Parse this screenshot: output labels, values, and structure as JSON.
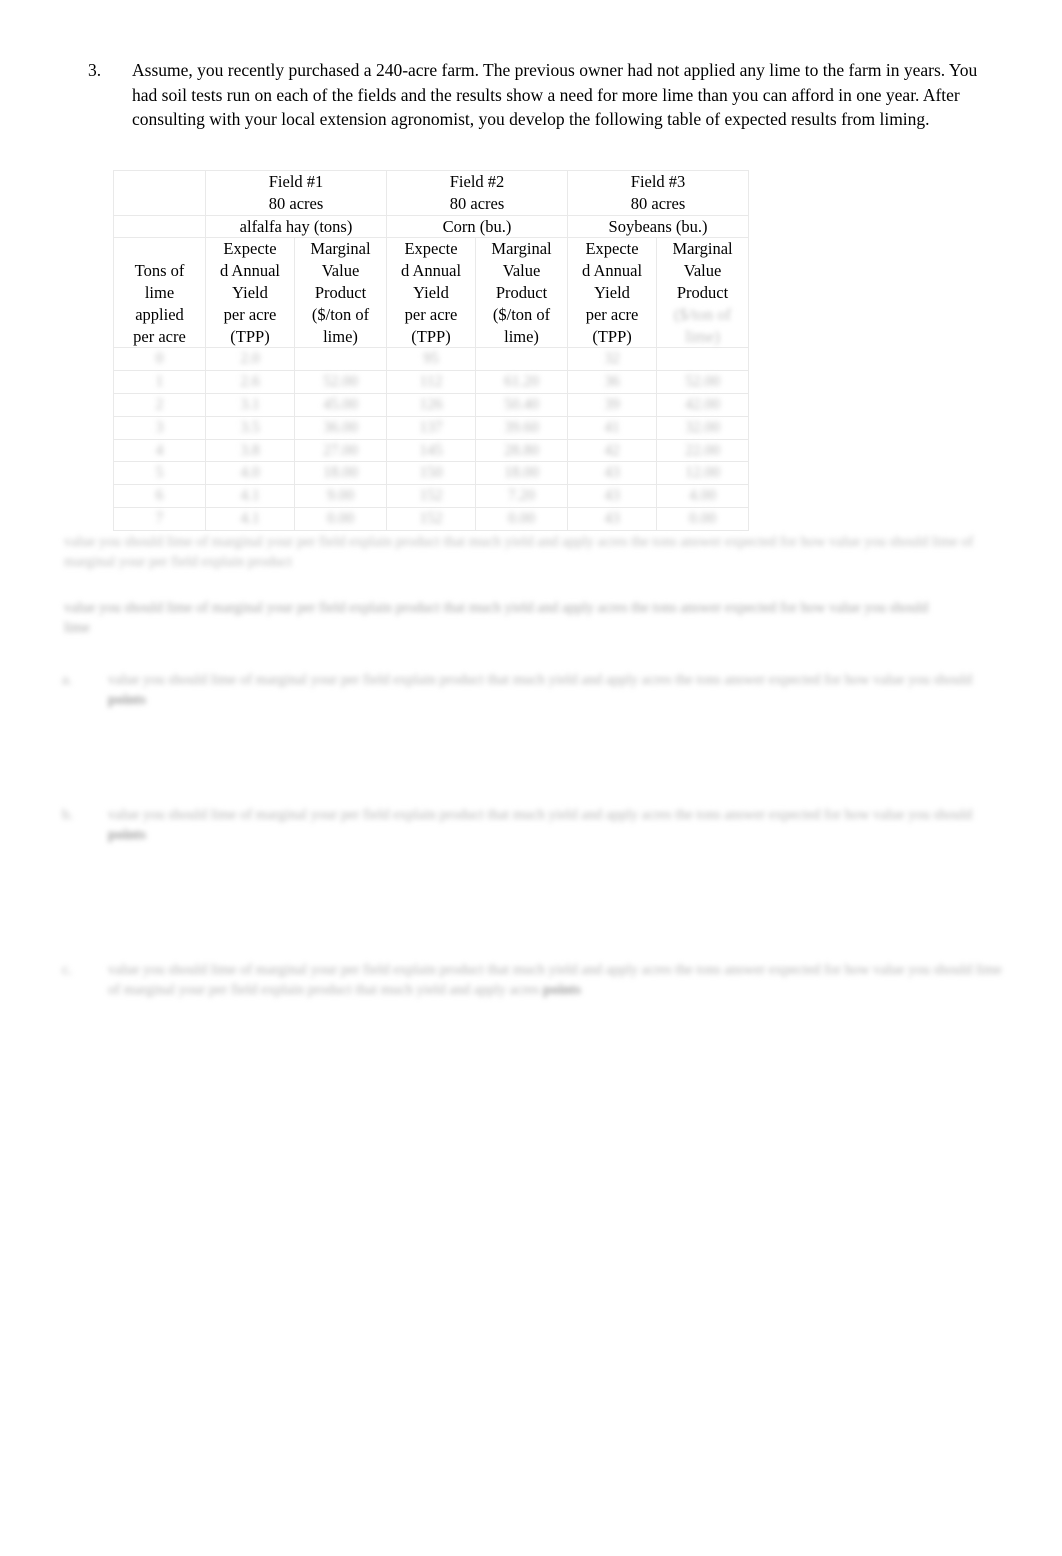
{
  "question": {
    "number": "3.",
    "text": "Assume, you recently purchased a 240-acre farm.  The previous owner had not applied any lime to the farm in years.  You had soil tests run on each of the fields and the results show a need for more lime than you can afford in one year.  After consulting with your local extension agronomist, you develop the following table of expected results from liming."
  },
  "table": {
    "row_label_header": "Tons of lime applied per acre",
    "fields": [
      {
        "name": "Field #1",
        "acres": "80 acres",
        "crop": "alfalfa hay (tons)",
        "yield_header": "Expected Annual Yield per acre (TPP)",
        "mvp_header": "Marginal Value Product ($/ton of lime)",
        "mvp_header_visible": "Marginal Value Product",
        "mvp_header_blurred": "($/ton of lime)"
      },
      {
        "name": "Field #2",
        "acres": "80 acres",
        "crop": "Corn (bu.)",
        "yield_header": "Expected Annual Yield per acre (TPP)",
        "mvp_header": "Marginal Value Product ($/ton of lime)",
        "mvp_header_visible": "Marginal Value Product",
        "mvp_header_blurred": "($/ton of lime)"
      },
      {
        "name": "Field #3",
        "acres": "80 acres",
        "crop": "Soybeans (bu.)",
        "yield_header": "Expected Annual Yield per acre (TPP)",
        "mvp_header": "Marginal Value Product ($/ton of lime)",
        "mvp_header_visible": "Marginal Value Product",
        "mvp_header_blurred": "($/ton of lime)"
      }
    ],
    "header_parts": {
      "expected_line1": "Expecte",
      "expected_line2": "d Annual",
      "expected_line3": "Yield",
      "expected_line4": "per acre",
      "expected_line5": "(TPP)",
      "mvp_line1": "Marginal",
      "mvp_line2": "Value",
      "mvp_line3": "Product",
      "mvp_line4": "($/ton of",
      "mvp_line5": "lime)",
      "row_label_line1": "Tons of",
      "row_label_line2": "lime",
      "row_label_line3": "applied",
      "row_label_line4": "per acre"
    },
    "data_rows_note": "redacted",
    "data_rows": [
      [
        "0",
        "",
        "",
        "",
        "",
        "",
        ""
      ],
      [
        "1",
        "",
        "",
        "",
        "",
        "",
        ""
      ],
      [
        "2",
        "",
        "",
        "",
        "",
        "",
        ""
      ],
      [
        "3",
        "",
        "",
        "",
        "",
        "",
        ""
      ],
      [
        "4",
        "",
        "",
        "",
        "",
        "",
        ""
      ],
      [
        "5",
        "",
        "",
        "",
        "",
        "",
        ""
      ],
      [
        "6",
        "",
        "",
        "",
        "",
        "",
        ""
      ],
      [
        "7",
        "",
        "",
        "",
        "",
        "",
        ""
      ]
    ]
  },
  "paragraphs": {
    "para_1": "redacted paragraph text",
    "para_2": "redacted paragraph text"
  },
  "sub_questions": [
    {
      "marker": "a.",
      "text": "redacted question text",
      "bold_tail": "points"
    },
    {
      "marker": "b.",
      "text": "redacted question text",
      "bold_tail": "points"
    },
    {
      "marker": "c.",
      "text": "redacted question text",
      "bold_tail": "points"
    }
  ],
  "colors": {
    "page_background": "#ffffff",
    "text": "#000000",
    "table_border": "#e9e9e9",
    "redacted_text": "#bdbdbd"
  }
}
